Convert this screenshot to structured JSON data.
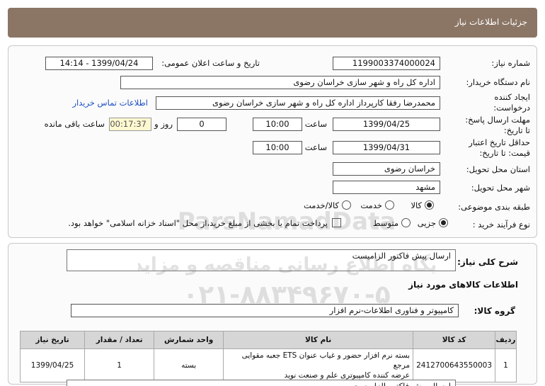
{
  "header": {
    "title": "جزئیات اطلاعات نیاز"
  },
  "form": {
    "need_number_label": "شماره نیاز:",
    "need_number": "1199003374000024",
    "announce_label": "تاریخ و ساعت اعلان عمومی:",
    "announce_value": "1399/04/24 - 14:14",
    "buyer_label": "نام دستگاه خریدار:",
    "buyer_value": "اداره کل راه و شهر سازی خراسان رضوی",
    "creator_label_1": "ایجاد کننده",
    "creator_label_2": "درخواست:",
    "creator_value": "محمدرضا رفقا کارپرداز اداره کل راه و شهر سازی خراسان رضوی",
    "contact_link": "اطلاعات تماس خریدار",
    "reply_label_1": "مهلت ارسال پاسخ:",
    "reply_label_2": "تا تاریخ:",
    "reply_date": "1399/04/25",
    "time_label": "ساعت",
    "reply_time": "10:00",
    "days_value": "0",
    "days_label": "روز و",
    "remaining_time": "00:17:37",
    "remaining_label": "ساعت باقی مانده",
    "validity_label_1": "حداقل تاریخ اعتبار",
    "validity_label_2": "قیمت: تا تاریخ:",
    "validity_date": "1399/04/31",
    "validity_time": "10:00",
    "province_label": "استان محل تحویل:",
    "province_value": "خراسان رضوی",
    "city_label": "شهر محل تحویل:",
    "city_value": "مشهد",
    "category_label": "طبقه بندی موضوعی:",
    "category_options": [
      "کالا",
      "خدمت",
      "کالا/خدمت"
    ],
    "process_label": "نوع فرآیند خرید :",
    "process_options": [
      "جزیی",
      "متوسط"
    ],
    "payment_note": "پرداخت تمام یا بخشی از مبلغ خرید،از محل \"اسناد خزانه اسلامی\" خواهد بود."
  },
  "description": {
    "summary_label": "شرح کلی نیاز:",
    "summary_value": "ارسال پیش فاکتور الزامیست",
    "goods_info_title": "اطلاعات کالاهای مورد نیاز",
    "goods_group_label": "گروه کالا:",
    "goods_group_value": "کامپیوتر و فناوری اطلاعات-نرم افزار"
  },
  "table": {
    "headers": [
      "ردیف",
      "کد کالا",
      "نام کالا",
      "واحد شمارش",
      "تعداد / مقدار",
      "تاریخ نیاز"
    ],
    "rows": [
      {
        "row": "1",
        "code": "2412700643550003",
        "name_line1": "بسته نرم افزار حضور و غیاب عنوان ETS جعبه مقوایی مرجع",
        "name_line2": "عرضه کننده کامپیوتری علم و صنعت نوید",
        "unit": "بسته",
        "qty": "1",
        "date": "1399/04/25"
      }
    ]
  },
  "watermark": {
    "brand": "ParsNamadData",
    "line1": "پایگاه اطلاع رسانی مناقصه و مزایده",
    "line2": "۰۲۱-۸۸۳۴۹۶۷۰-۵"
  }
}
